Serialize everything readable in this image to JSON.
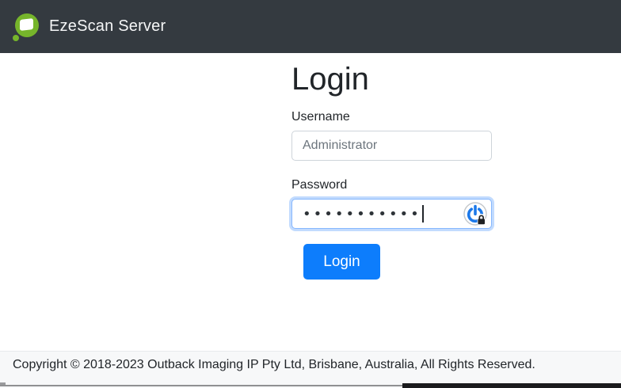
{
  "header": {
    "app_title": "EzeScan Server",
    "brand_color": "#76b52b",
    "background_color": "#343a40"
  },
  "login": {
    "title": "Login",
    "username": {
      "label": "Username",
      "value": "Administrator"
    },
    "password": {
      "label": "Password",
      "masked_value": "•••••••••••",
      "focused": true
    },
    "submit_label": "Login",
    "accent_color": "#0d7dfc",
    "focus_ring_color": "#86b7fe"
  },
  "footer": {
    "copyright": "Copyright © 2018-2023 Outback Imaging IP Pty Ltd, Brisbane, Australia, All Rights Reserved."
  }
}
